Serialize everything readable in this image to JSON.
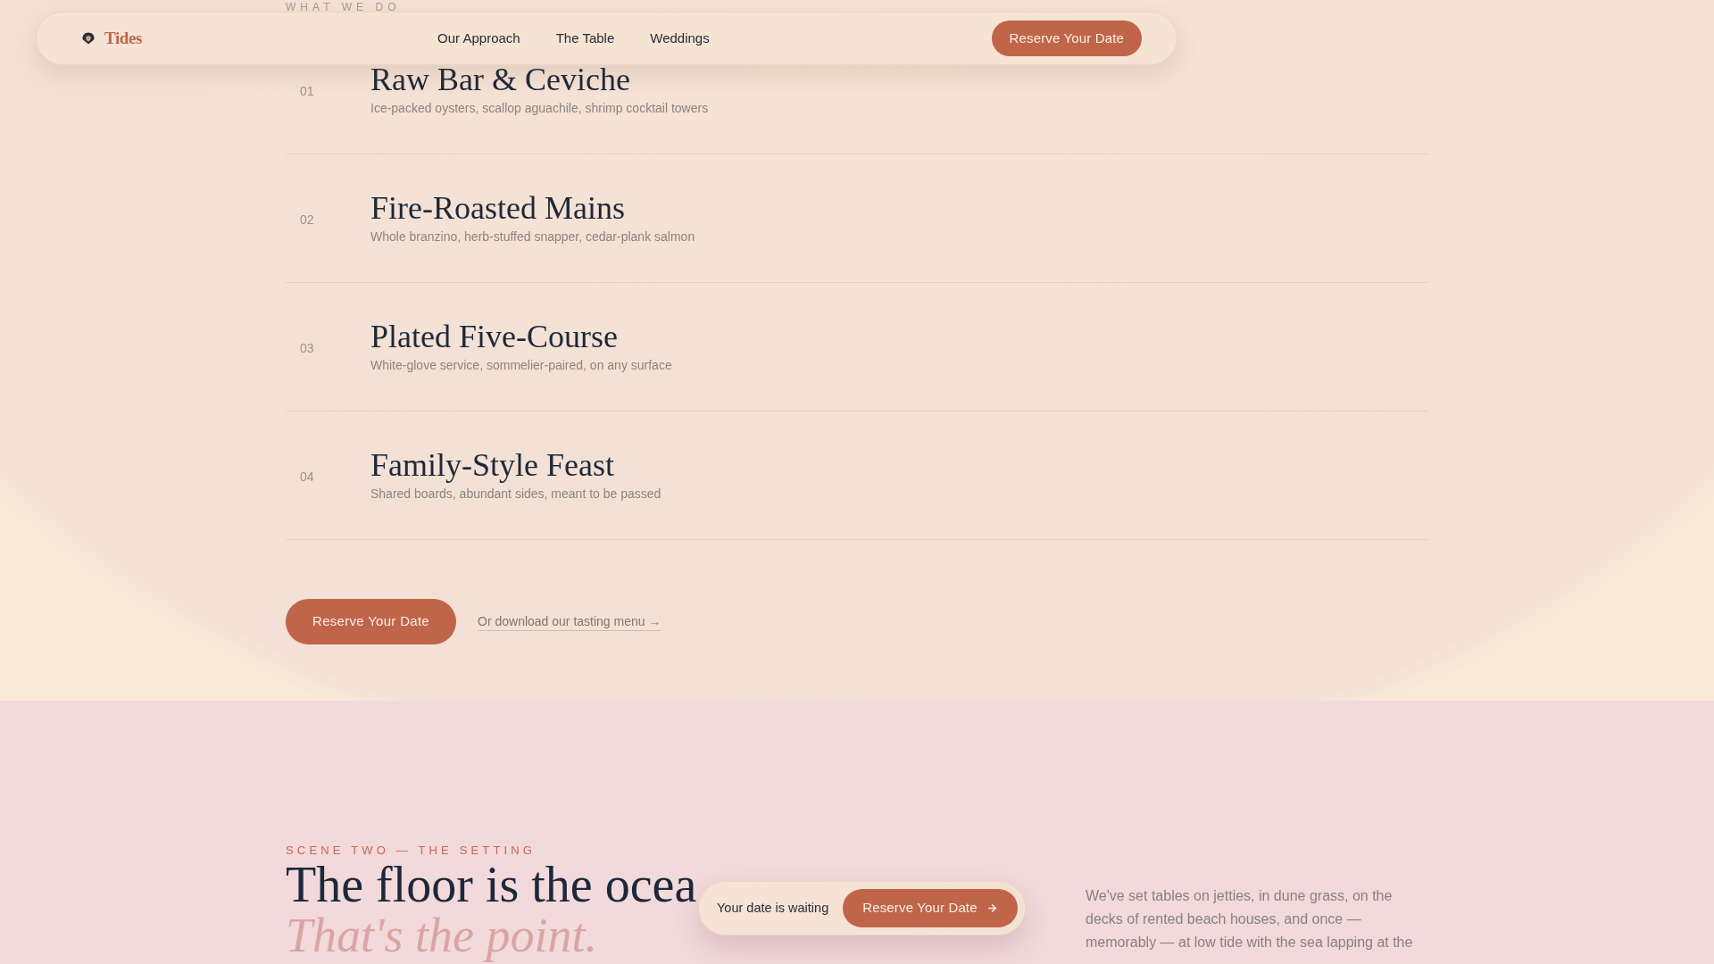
{
  "section_eyebrow": "WHAT WE DO",
  "nav": {
    "logo": "Tides",
    "links": [
      "Our Approach",
      "The Table",
      "Weddings"
    ],
    "cta": "Reserve Your Date"
  },
  "services": [
    {
      "number": "01",
      "title": "Raw Bar & Ceviche",
      "description": "Ice-packed oysters, scallop aguachile, shrimp cocktail towers"
    },
    {
      "number": "02",
      "title": "Fire-Roasted Mains",
      "description": "Whole branzino, herb-stuffed snapper, cedar-plank salmon"
    },
    {
      "number": "03",
      "title": "Plated Five-Course",
      "description": "White-glove service, sommelier-paired, on any surface"
    },
    {
      "number": "04",
      "title": "Family-Style Feast",
      "description": "Shared boards, abundant sides, meant to be passed"
    }
  ],
  "actions": {
    "primary": "Reserve Your Date",
    "link": "Or download our tasting menu →"
  },
  "setting": {
    "eyebrow": "SCENE TWO — THE SETTING",
    "headline": "The floor is the ocea",
    "tagline": "That's the point.",
    "body": "We've set tables on jetties, in dune grass, on the decks of rented beach houses, and once — memorably — at low tide with the sea lapping at the"
  },
  "sticky_bar": {
    "text": "Your date is waiting",
    "button": "Reserve Your Date"
  }
}
